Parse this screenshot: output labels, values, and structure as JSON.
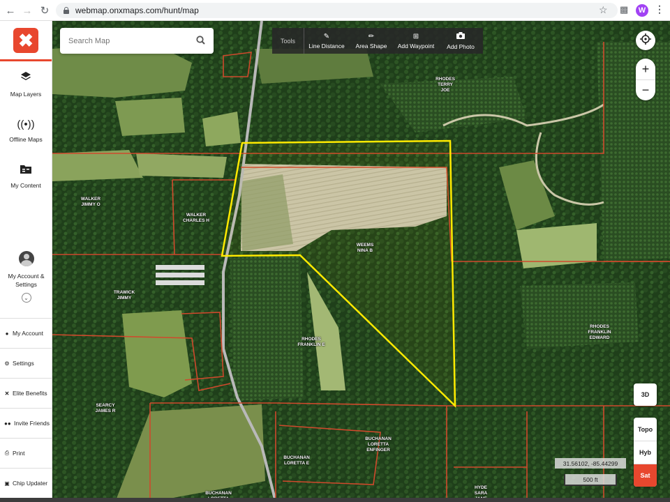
{
  "browser": {
    "url": "webmap.onxmaps.com/hunt/map",
    "profile_initial": "W"
  },
  "sidebar": {
    "main_items": [
      {
        "label": "Map Layers",
        "icon": "layers-icon"
      },
      {
        "label": "Offline Maps",
        "icon": "broadcast-icon"
      },
      {
        "label": "My Content",
        "icon": "folder-icon"
      }
    ],
    "account_label": "My Account &\nSettings",
    "list_items": [
      {
        "label": "My Account",
        "icon": "user-icon"
      },
      {
        "label": "Settings",
        "icon": "gear-icon"
      },
      {
        "label": "Elite Benefits",
        "icon": "x-icon"
      },
      {
        "label": "Invite Friends",
        "icon": "users-icon"
      },
      {
        "label": "Print",
        "icon": "print-icon"
      },
      {
        "label": "Chip Updater",
        "icon": "chip-icon"
      }
    ]
  },
  "search": {
    "placeholder": "Search Map"
  },
  "toolbar": {
    "label": "Tools",
    "buttons": [
      {
        "label": "Line Distance",
        "icon": "pencil-icon"
      },
      {
        "label": "Area Shape",
        "icon": "shape-icon"
      },
      {
        "label": "Add Waypoint",
        "icon": "waypoint-icon"
      },
      {
        "label": "Add Photo",
        "icon": "camera-icon"
      }
    ]
  },
  "map_controls": {
    "zoom_in": "+",
    "zoom_out": "−",
    "btn_3d": "3D",
    "layers": [
      "Topo",
      "Hyb",
      "Sat"
    ],
    "active_layer": "Sat",
    "coordinates": "31.56102, -85.44299",
    "scale": "500 ft"
  },
  "owners": [
    {
      "name": "RHODES\nTERRY\nJOE"
    },
    {
      "name": "WALKER\nJIMMY O"
    },
    {
      "name": "WALKER\nCHARLES H"
    },
    {
      "name": "WEEMS\nNINA B"
    },
    {
      "name": "TRAWICK\nJIMMY"
    },
    {
      "name": "RHODES\nFRANKLIN E"
    },
    {
      "name": "RHODES\nFRANKLIN\nEDWARD"
    },
    {
      "name": "SEARCY\nJAMES R"
    },
    {
      "name": "BUCHANAN\nLORETTA\nENFINGER"
    },
    {
      "name": "BUCHANAN\nLORETTA E"
    },
    {
      "name": "HYDE\nSARA\nJANE"
    },
    {
      "name": "BUCHANAN\nLORETTA"
    }
  ],
  "colors": {
    "brand": "#e8472e",
    "boundary": "#d0492c",
    "selection": "#ffea00"
  }
}
